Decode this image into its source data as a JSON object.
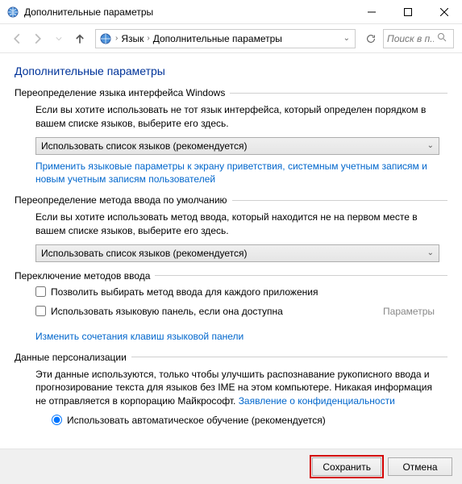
{
  "window": {
    "title": "Дополнительные параметры"
  },
  "nav": {
    "breadcrumb_root": "Язык",
    "breadcrumb_current": "Дополнительные параметры",
    "search_placeholder": "Поиск в п..."
  },
  "page": {
    "title": "Дополнительные параметры"
  },
  "group1": {
    "header": "Переопределение языка интерфейса Windows",
    "desc": "Если вы хотите использовать не тот язык интерфейса, который определен порядком в вашем списке языков, выберите его здесь.",
    "combo": "Использовать список языков (рекомендуется)",
    "link": "Применить языковые параметры к экрану приветствия, системным учетным записям и новым учетным записям пользователей"
  },
  "group2": {
    "header": "Переопределение метода ввода по умолчанию",
    "desc": "Если вы хотите использовать метод ввода, который находится не на первом месте в вашем списке языков, выберите его здесь.",
    "combo": "Использовать список языков (рекомендуется)"
  },
  "group3": {
    "header": "Переключение методов ввода",
    "check1": "Позволить выбирать метод ввода для каждого приложения",
    "check2": "Использовать языковую панель, если она доступна",
    "params": "Параметры",
    "link": "Изменить сочетания клавиш языковой панели"
  },
  "group4": {
    "header": "Данные персонализации",
    "desc_part1": "Эти данные используются, только чтобы улучшить распознавание рукописного ввода и прогнозирование текста для языков без IME на этом компьютере. Никакая информация не отправляется в корпорацию Майкрософт. ",
    "privacy_link": "Заявление о конфиденциальности",
    "radio": "Использовать автоматическое обучение (рекомендуется)"
  },
  "footer": {
    "save": "Сохранить",
    "cancel": "Отмена"
  }
}
